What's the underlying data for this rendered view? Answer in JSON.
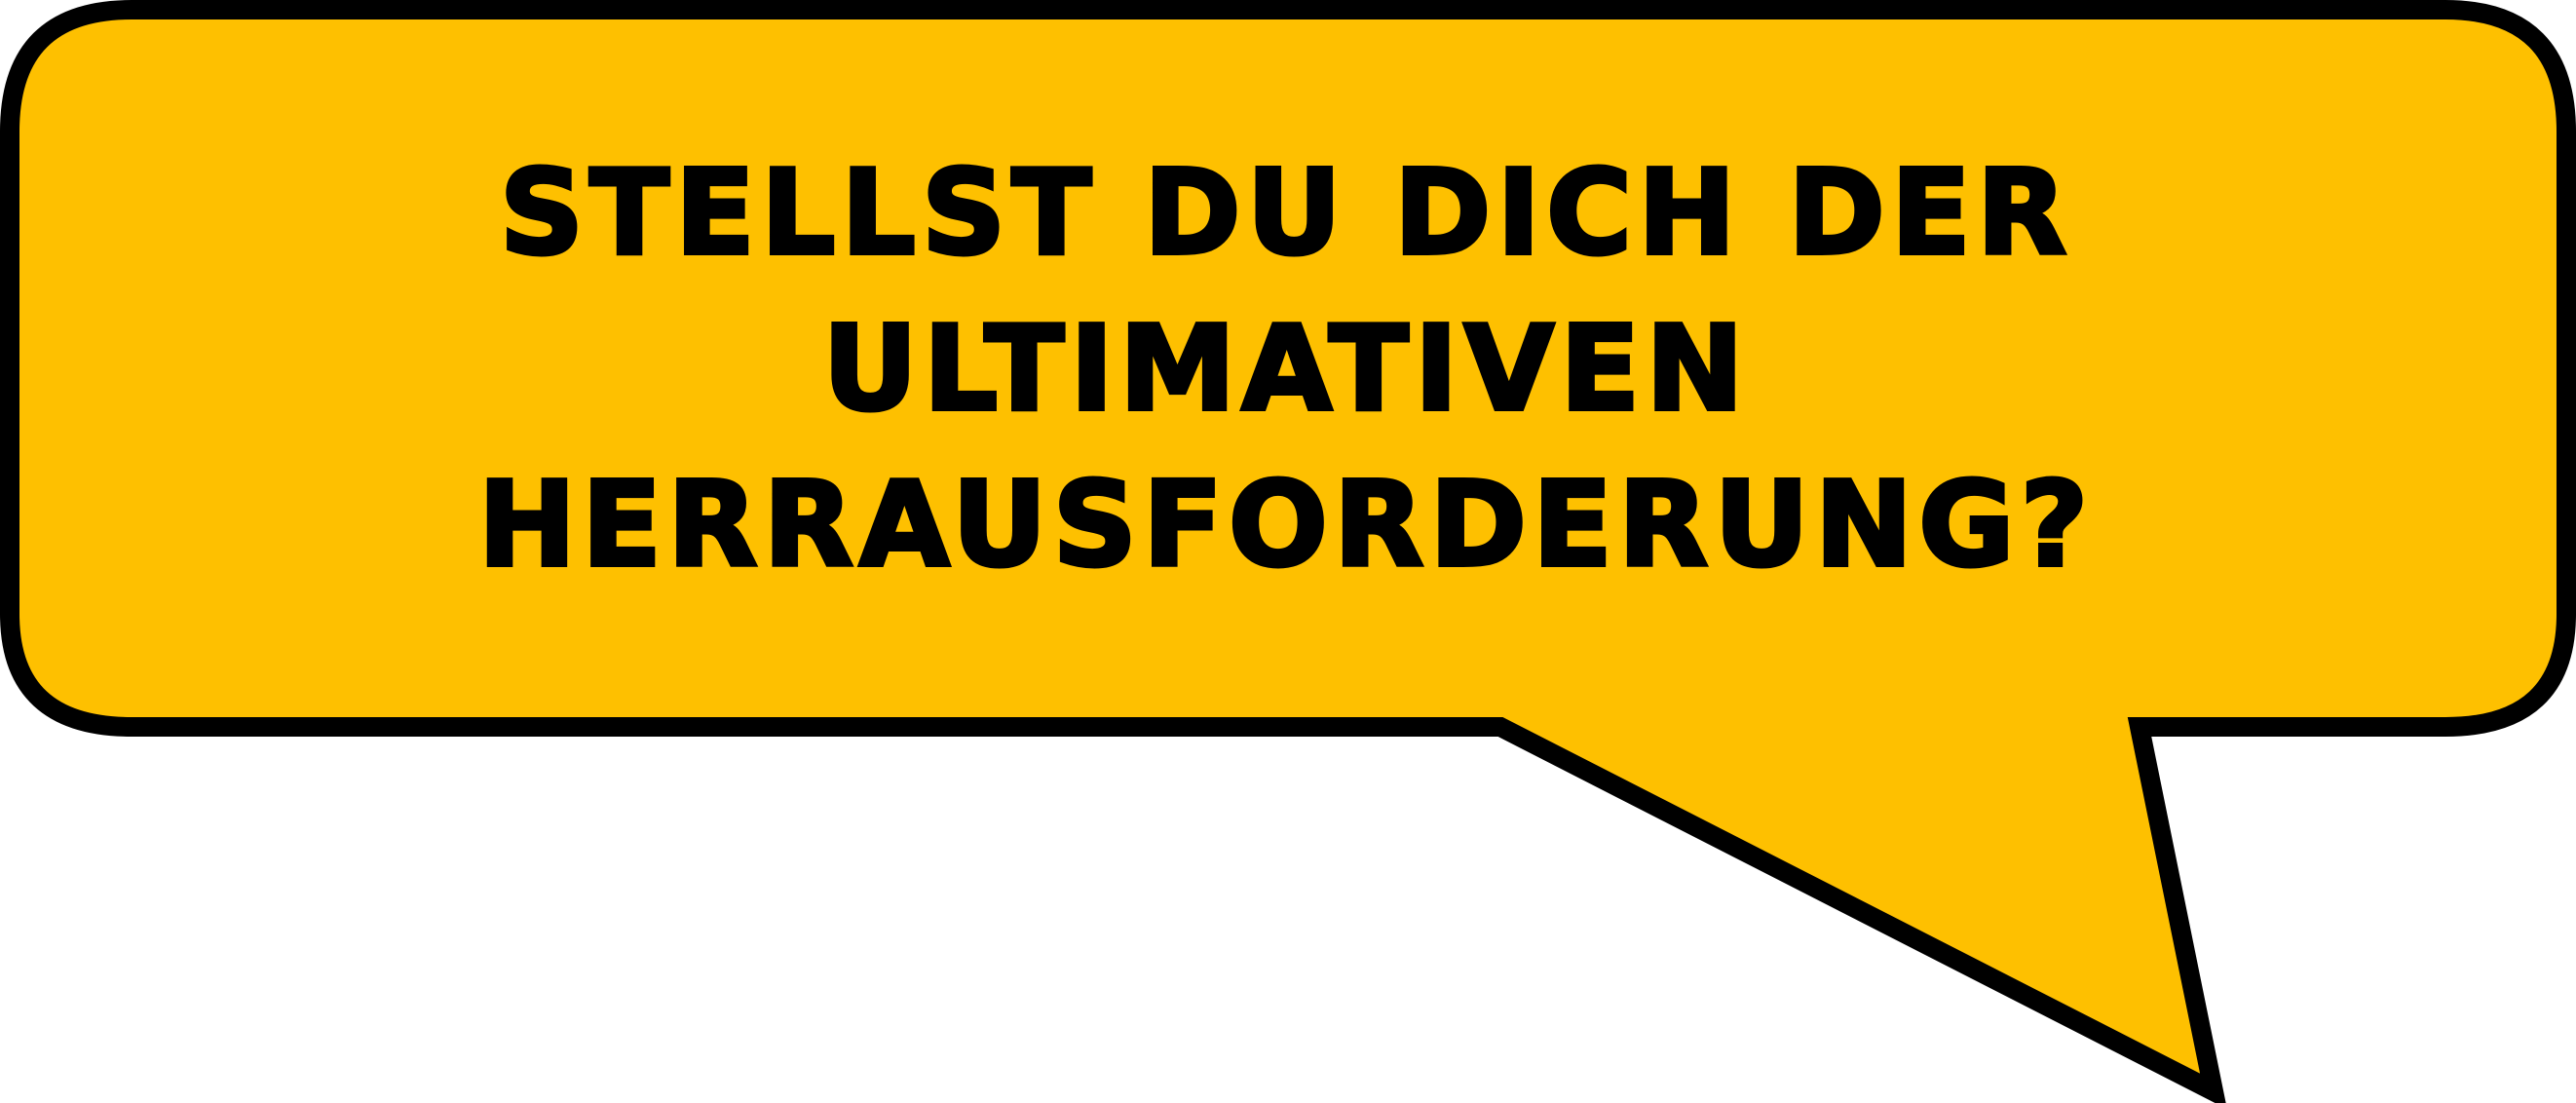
{
  "speech_bubble": {
    "lines": [
      "STELLST DU DICH DER",
      "ULTIMATIVEN",
      "HERRAUSFORDERUNG?"
    ],
    "fill_color": "#FEC000",
    "outline_color": "#000000",
    "text_color": "#000000"
  }
}
